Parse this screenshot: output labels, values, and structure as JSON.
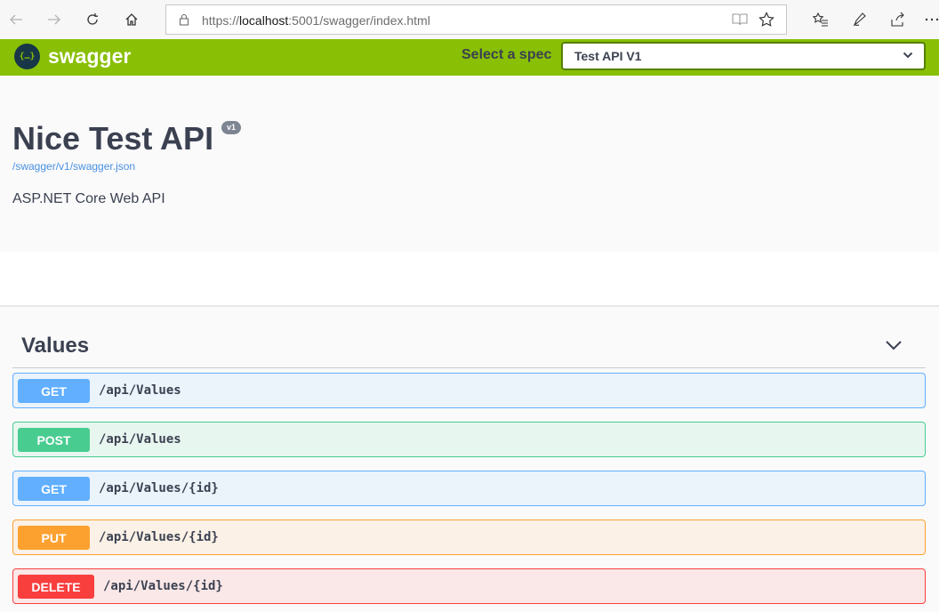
{
  "browser": {
    "url_prefix": "https://",
    "url_host": "localhost",
    "url_rest": ":5001/swagger/index.html"
  },
  "topbar": {
    "logo_glyph": "{…}",
    "logo_text": "swagger",
    "spec_label": "Select a spec",
    "spec_value": "Test API V1"
  },
  "info": {
    "title": "Nice Test API",
    "version": "v1",
    "spec_link": "/swagger/v1/swagger.json",
    "description": "ASP.NET Core Web API"
  },
  "tag": {
    "name": "Values",
    "operations": [
      {
        "method": "GET",
        "path": "/api/Values"
      },
      {
        "method": "POST",
        "path": "/api/Values"
      },
      {
        "method": "GET",
        "path": "/api/Values/{id}"
      },
      {
        "method": "PUT",
        "path": "/api/Values/{id}"
      },
      {
        "method": "DELETE",
        "path": "/api/Values/{id}"
      }
    ]
  },
  "colors": {
    "topbar": "#89bf04",
    "get": "#61affe",
    "post": "#49cc90",
    "put": "#fca130",
    "delete": "#f93e3e"
  }
}
